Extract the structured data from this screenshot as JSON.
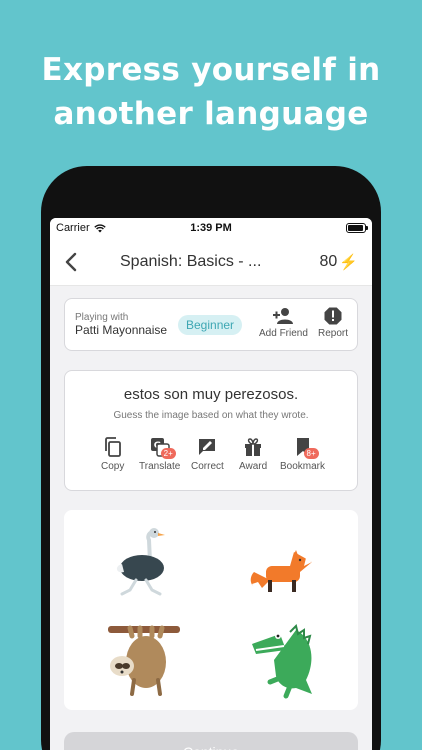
{
  "promo": {
    "headline_line1": "Express yourself in",
    "headline_line2": "another language"
  },
  "status": {
    "carrier": "Carrier",
    "time": "1:39 PM"
  },
  "nav": {
    "title": "Spanish: Basics - ...",
    "points": "80",
    "back_icon": "chevron-left-icon",
    "points_icon": "lightning-bolt-icon"
  },
  "partner": {
    "playing_with_label": "Playing with",
    "name": "Patti Mayonnaise",
    "level": "Beginner",
    "add_friend_label": "Add Friend",
    "report_label": "Report"
  },
  "message": {
    "text": "estos son muy perezosos.",
    "hint": "Guess the image based on what they wrote.",
    "actions": [
      {
        "label": "Copy",
        "icon": "copy-icon"
      },
      {
        "label": "Translate",
        "icon": "translate-icon",
        "count": "2+"
      },
      {
        "label": "Correct",
        "icon": "correct-icon"
      },
      {
        "label": "Award",
        "icon": "gift-icon"
      },
      {
        "label": "Bookmark",
        "icon": "bookmark-icon",
        "count": "8+"
      }
    ]
  },
  "images": [
    "ostrich",
    "fox",
    "sloth",
    "crocodile"
  ],
  "colors": {
    "background": "#62c5cc",
    "accent": "#3ea7b3",
    "badge_bg": "#d6f0f3",
    "count_badge": "#ef6a5c",
    "bolt": "#f5b82e"
  },
  "continue_label": "Continue"
}
